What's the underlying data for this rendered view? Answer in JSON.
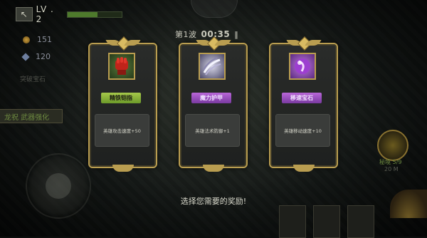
{
  "hud": {
    "back_icon": "back-arrow-icon",
    "level_label": "LV . 2",
    "level_progress": 0.55,
    "coins": "151",
    "gems": "120",
    "faded_label": "突破宝石",
    "side_button": "龙祝 武器强化"
  },
  "timer": {
    "wave": "第1波",
    "time": "00:35",
    "pause_icon": "pause-icon"
  },
  "rewards": [
    {
      "name": "精铁铠指",
      "desc": "英雄攻击速度+50",
      "icon": "red-fist-icon",
      "tag_color": "#8fb83a"
    },
    {
      "name": "魔力护甲",
      "desc": "英雄法术防御+1",
      "icon": "silver-claw-icon",
      "tag_color": "#a55ac8"
    },
    {
      "name": "移速宝石",
      "desc": "英雄移动速度+10",
      "icon": "purple-orb-icon",
      "tag_color": "#a55ac8"
    }
  ],
  "prompt": "选择您需要的奖励!",
  "right": {
    "label1": "秘境 5/9",
    "label2": "20 M"
  },
  "colors": {
    "frame_gold": "#b99d50",
    "text_green": "#6d8a40"
  }
}
